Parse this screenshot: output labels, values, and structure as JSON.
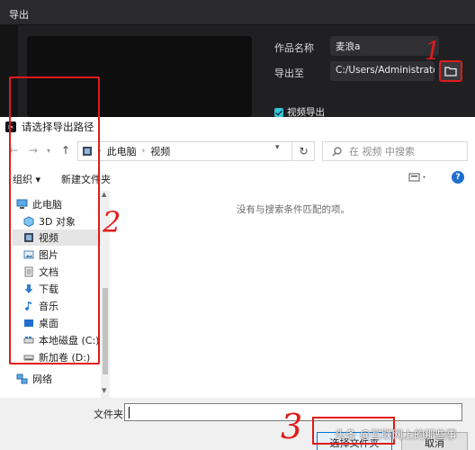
{
  "export_dialog": {
    "title": "导出",
    "name_label": "作品名称",
    "name_value": "麦浪a",
    "export_to_label": "导出至",
    "export_path": "C:/Users/Administrator/...",
    "video_export_label": "视频导出",
    "video_export_checked": true
  },
  "file_picker": {
    "title": "请选择导出路径",
    "breadcrumb": [
      "此电脑",
      "视频"
    ],
    "search_placeholder": "在 视频 中搜索",
    "toolbar": {
      "organize": "组织 ▾",
      "new_folder": "新建文件夹"
    },
    "nav_items": [
      {
        "label": "此电脑",
        "icon": "pc-icon"
      },
      {
        "label": "3D 对象",
        "icon": "cube-icon"
      },
      {
        "label": "视频",
        "icon": "video-icon",
        "selected": true
      },
      {
        "label": "图片",
        "icon": "picture-icon"
      },
      {
        "label": "文档",
        "icon": "document-icon"
      },
      {
        "label": "下载",
        "icon": "download-icon"
      },
      {
        "label": "音乐",
        "icon": "music-icon"
      },
      {
        "label": "桌面",
        "icon": "desktop-icon"
      },
      {
        "label": "本地磁盘 (C:)",
        "icon": "drive-icon"
      },
      {
        "label": "新加卷 (D:)",
        "icon": "drive-icon"
      },
      {
        "label": "网络",
        "icon": "network-icon"
      }
    ],
    "empty_message": "没有与搜索条件匹配的项。",
    "folder_label": "文件夹:",
    "folder_value": "",
    "select_button": "选择文件夹",
    "cancel_button": "取消"
  },
  "annotations": [
    "1",
    "2",
    "3"
  ],
  "watermark": "头条 @互联网上的那些事",
  "colors": {
    "highlight_red": "#e01b1b",
    "accent_blue": "#0078d7",
    "checkbox_cyan": "#38c3d8"
  }
}
